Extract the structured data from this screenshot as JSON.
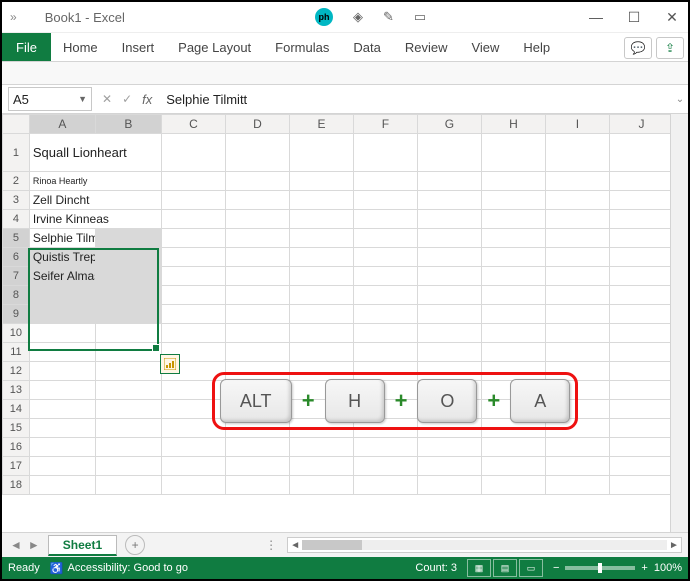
{
  "title": "Book1  -  Excel",
  "tabs": {
    "file": "File",
    "home": "Home",
    "insert": "Insert",
    "pagelayout": "Page Layout",
    "formulas": "Formulas",
    "data": "Data",
    "review": "Review",
    "view": "View",
    "help": "Help"
  },
  "namebox": "A5",
  "formula": "Selphie Tilmitt",
  "columns": [
    "A",
    "B",
    "C",
    "D",
    "E",
    "F",
    "G",
    "H",
    "I",
    "J"
  ],
  "rows": [
    "1",
    "2",
    "3",
    "4",
    "5",
    "6",
    "7",
    "8",
    "9",
    "10",
    "11",
    "12",
    "13",
    "14",
    "15",
    "16",
    "17",
    "18"
  ],
  "cells": {
    "A1": "Squall Lionheart",
    "A2": "Rinoa Heartly",
    "A3": "Zell Dincht",
    "A4": "Irvine Kinneas",
    "A5": "Selphie Tilmitt",
    "A6": "Quistis Trepe",
    "A7": "Seifer Almasy"
  },
  "overlay_keys": [
    "ALT",
    "H",
    "O",
    "A"
  ],
  "sheet_tab": "Sheet1",
  "status": {
    "ready": "Ready",
    "accessibility": "Accessibility: Good to go",
    "count": "Count: 3",
    "zoom": "100%"
  }
}
